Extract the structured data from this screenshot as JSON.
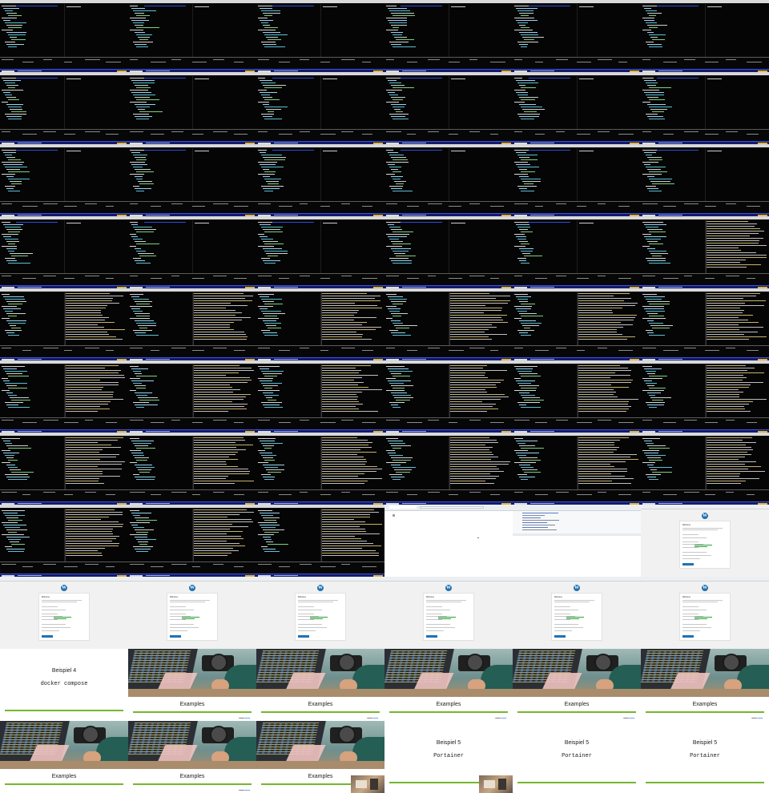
{
  "grid": {
    "columns": 6,
    "rows": 11
  },
  "tiles": [
    {
      "kind": "term",
      "split": false
    },
    {
      "kind": "term",
      "split": false
    },
    {
      "kind": "term",
      "split": false
    },
    {
      "kind": "term",
      "split": false
    },
    {
      "kind": "term",
      "split": false
    },
    {
      "kind": "term",
      "split": false
    },
    {
      "kind": "term",
      "split": false
    },
    {
      "kind": "term",
      "split": false
    },
    {
      "kind": "term",
      "split": false
    },
    {
      "kind": "term",
      "split": false
    },
    {
      "kind": "term",
      "split": false
    },
    {
      "kind": "term",
      "split": false
    },
    {
      "kind": "term",
      "split": false
    },
    {
      "kind": "term",
      "split": false
    },
    {
      "kind": "term",
      "split": false
    },
    {
      "kind": "term",
      "split": false
    },
    {
      "kind": "term",
      "split": false
    },
    {
      "kind": "term",
      "split": false
    },
    {
      "kind": "term",
      "split": false
    },
    {
      "kind": "term",
      "split": false
    },
    {
      "kind": "term",
      "split": false
    },
    {
      "kind": "term",
      "split": false
    },
    {
      "kind": "term",
      "split": false
    },
    {
      "kind": "term",
      "split": true
    },
    {
      "kind": "term",
      "split": true
    },
    {
      "kind": "term",
      "split": true
    },
    {
      "kind": "term",
      "split": true
    },
    {
      "kind": "term",
      "split": true
    },
    {
      "kind": "term",
      "split": true
    },
    {
      "kind": "term",
      "split": true
    },
    {
      "kind": "term",
      "split": true
    },
    {
      "kind": "term",
      "split": true
    },
    {
      "kind": "term",
      "split": true
    },
    {
      "kind": "term",
      "split": true
    },
    {
      "kind": "term",
      "split": true
    },
    {
      "kind": "term",
      "split": true
    },
    {
      "kind": "term",
      "split": true
    },
    {
      "kind": "term",
      "split": true
    },
    {
      "kind": "term",
      "split": true
    },
    {
      "kind": "term",
      "split": true
    },
    {
      "kind": "term",
      "split": true
    },
    {
      "kind": "term",
      "split": true
    },
    {
      "kind": "term",
      "split": true
    },
    {
      "kind": "term",
      "split": true
    },
    {
      "kind": "term",
      "split": true
    },
    {
      "kind": "browser"
    },
    {
      "kind": "devtools"
    },
    {
      "kind": "wp"
    },
    {
      "kind": "wp"
    },
    {
      "kind": "wp"
    },
    {
      "kind": "wp"
    },
    {
      "kind": "wp"
    },
    {
      "kind": "wp"
    },
    {
      "kind": "wp"
    },
    {
      "kind": "slide_title",
      "title": "Beispiel 4",
      "subtitle": "docker compose"
    },
    {
      "kind": "slide_photo",
      "title": "Examples",
      "credit": true
    },
    {
      "kind": "slide_photo",
      "title": "Examples",
      "credit": true
    },
    {
      "kind": "slide_photo",
      "title": "Examples",
      "credit": true
    },
    {
      "kind": "slide_photo",
      "title": "Examples",
      "credit": true
    },
    {
      "kind": "slide_photo",
      "title": "Examples",
      "credit": true
    },
    {
      "kind": "slide_photo",
      "title": "Examples",
      "credit": false
    },
    {
      "kind": "slide_photo",
      "title": "Examples",
      "credit": true
    },
    {
      "kind": "slide_photo",
      "title": "Examples",
      "credit": false,
      "thumb": "right"
    },
    {
      "kind": "slide_title",
      "title": "Beispiel 5",
      "subtitle": "Portainer",
      "thumb": "right"
    },
    {
      "kind": "slide_title",
      "title": "Beispiel 5",
      "subtitle": "Portainer"
    },
    {
      "kind": "slide_title",
      "title": "Beispiel 5",
      "subtitle": "Portainer"
    }
  ],
  "wp": {
    "logo_glyph": "W",
    "heading": "Welcome"
  },
  "colors": {
    "terminal_bg": "#050505",
    "taskbar": "#141a6b",
    "accent_green": "#74b72e",
    "wp_blue": "#2271b1"
  }
}
